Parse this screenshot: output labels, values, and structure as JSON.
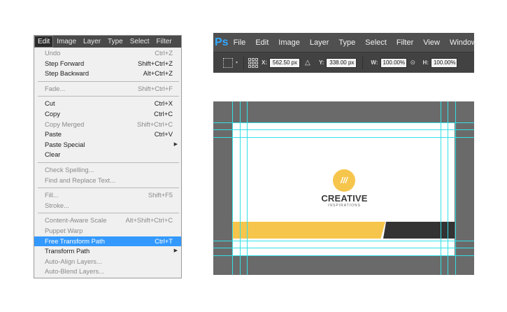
{
  "edit_menu": {
    "menubar": [
      {
        "label": "Edit",
        "active": true
      },
      {
        "label": "Image",
        "active": false
      },
      {
        "label": "Layer",
        "active": false
      },
      {
        "label": "Type",
        "active": false
      },
      {
        "label": "Select",
        "active": false
      },
      {
        "label": "Filter",
        "active": false
      }
    ],
    "items": [
      {
        "label": "Undo",
        "shortcut": "Ctrl+Z",
        "disabled": true
      },
      {
        "label": "Step Forward",
        "shortcut": "Shift+Ctrl+Z",
        "disabled": false
      },
      {
        "label": "Step Backward",
        "shortcut": "Alt+Ctrl+Z",
        "disabled": false
      },
      {
        "separator": true
      },
      {
        "label": "Fade...",
        "shortcut": "Shift+Ctrl+F",
        "disabled": true
      },
      {
        "separator": true
      },
      {
        "label": "Cut",
        "shortcut": "Ctrl+X",
        "disabled": false
      },
      {
        "label": "Copy",
        "shortcut": "Ctrl+C",
        "disabled": false
      },
      {
        "label": "Copy Merged",
        "shortcut": "Shift+Ctrl+C",
        "disabled": true
      },
      {
        "label": "Paste",
        "shortcut": "Ctrl+V",
        "disabled": false
      },
      {
        "label": "Paste Special",
        "shortcut": "",
        "disabled": false,
        "submenu": true
      },
      {
        "label": "Clear",
        "shortcut": "",
        "disabled": false
      },
      {
        "separator": true
      },
      {
        "label": "Check Spelling...",
        "shortcut": "",
        "disabled": true
      },
      {
        "label": "Find and Replace Text...",
        "shortcut": "",
        "disabled": true
      },
      {
        "separator": true
      },
      {
        "label": "Fill...",
        "shortcut": "Shift+F5",
        "disabled": true
      },
      {
        "label": "Stroke...",
        "shortcut": "",
        "disabled": true
      },
      {
        "separator": true
      },
      {
        "label": "Content-Aware Scale",
        "shortcut": "Alt+Shift+Ctrl+C",
        "disabled": true
      },
      {
        "label": "Puppet Warp",
        "shortcut": "",
        "disabled": true
      },
      {
        "label": "Free Transform Path",
        "shortcut": "Ctrl+T",
        "disabled": false,
        "highlight": true
      },
      {
        "label": "Transform Path",
        "shortcut": "",
        "disabled": false,
        "submenu": true
      },
      {
        "label": "Auto-Align Layers...",
        "shortcut": "",
        "disabled": true
      },
      {
        "label": "Auto-Blend Layers...",
        "shortcut": "",
        "disabled": true
      }
    ],
    "arrow_glyph": "▶"
  },
  "ps_bar": {
    "logo": "Ps",
    "menus": [
      "File",
      "Edit",
      "Image",
      "Layer",
      "Type",
      "Select",
      "Filter",
      "View",
      "Window"
    ],
    "options": {
      "x_label": "X:",
      "x_value": "562.50 px",
      "y_label": "Y:",
      "y_value": "338.00 px",
      "w_label": "W:",
      "w_value": "100.00%",
      "h_label": "H:",
      "h_value": "100.00%",
      "caret": "▾",
      "triangle": "△",
      "link": "⊝"
    }
  },
  "canvas": {
    "logo_mark": "///",
    "title": "CREATIVE",
    "subtitle": "INSPIRATIONS",
    "colors": {
      "accent": "#f6c54b",
      "dark": "#333333",
      "guide": "#33e0e6"
    }
  }
}
